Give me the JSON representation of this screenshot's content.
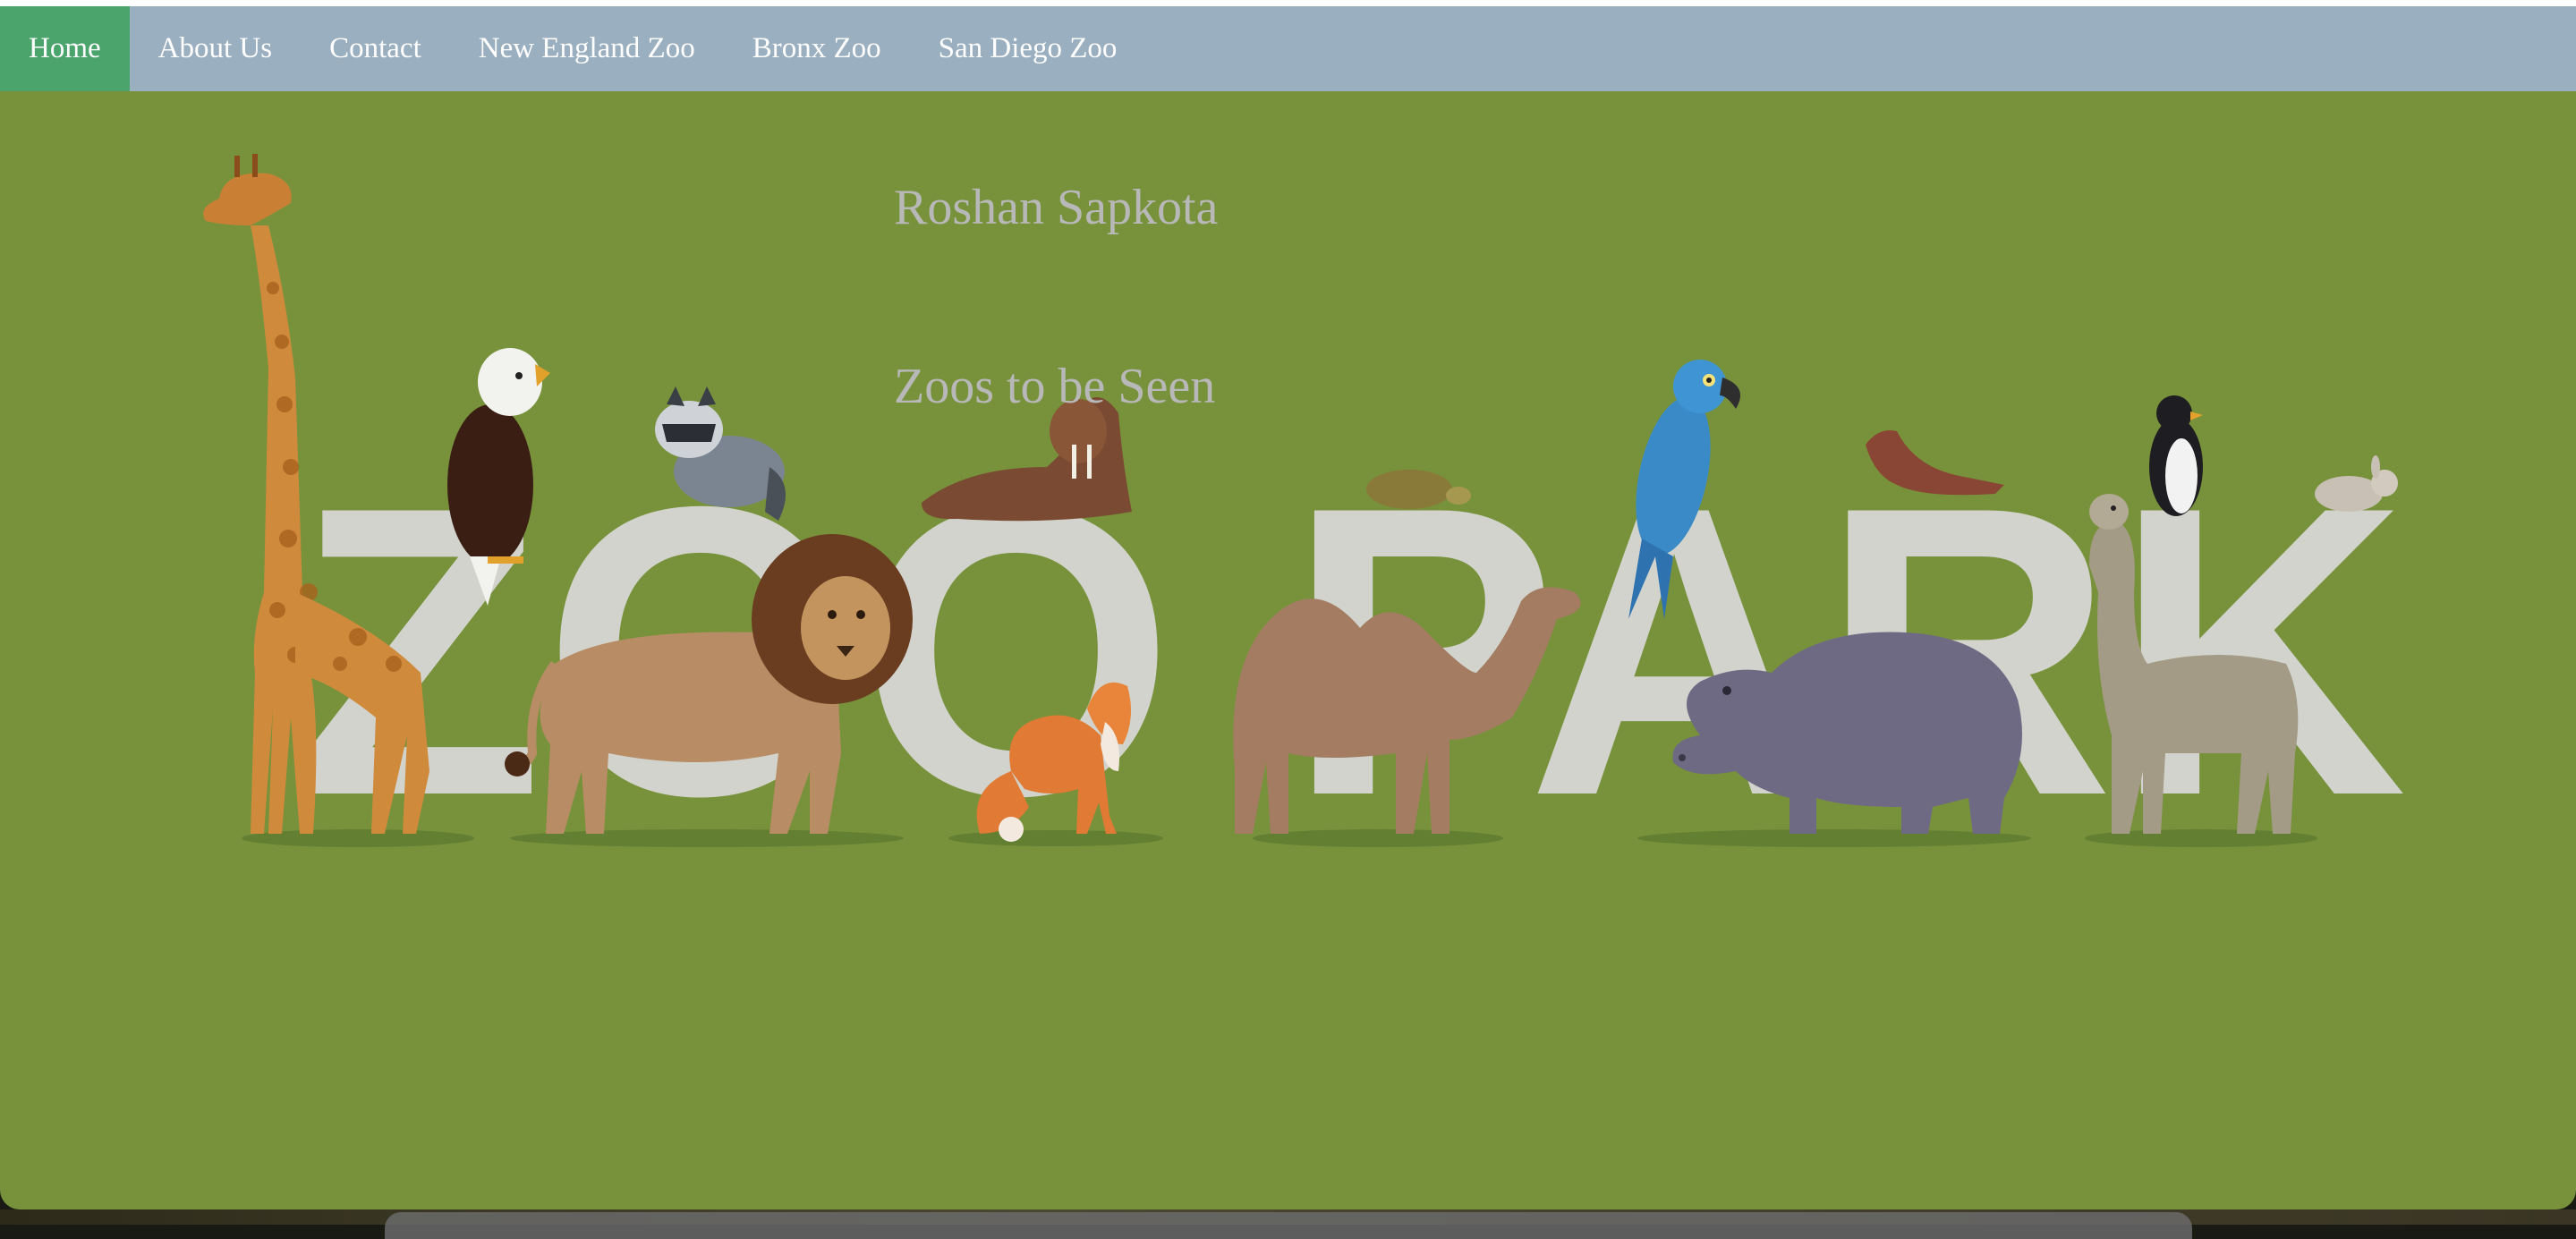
{
  "nav": {
    "items": [
      {
        "label": "Home",
        "active": true
      },
      {
        "label": "About Us",
        "active": false
      },
      {
        "label": "Contact",
        "active": false
      },
      {
        "label": "New England Zoo",
        "active": false
      },
      {
        "label": "Bronx Zoo",
        "active": false
      },
      {
        "label": "San Diego Zoo",
        "active": false
      }
    ]
  },
  "hero": {
    "title": "Roshan Sapkota",
    "subtitle": "Zoos to be Seen",
    "banner_text": "ZOO PARK"
  },
  "colors": {
    "nav_bg": "#9aafc0",
    "nav_active": "#4ba46c",
    "page_bg": "#78923c",
    "hero_text": "#b8b8b8"
  }
}
